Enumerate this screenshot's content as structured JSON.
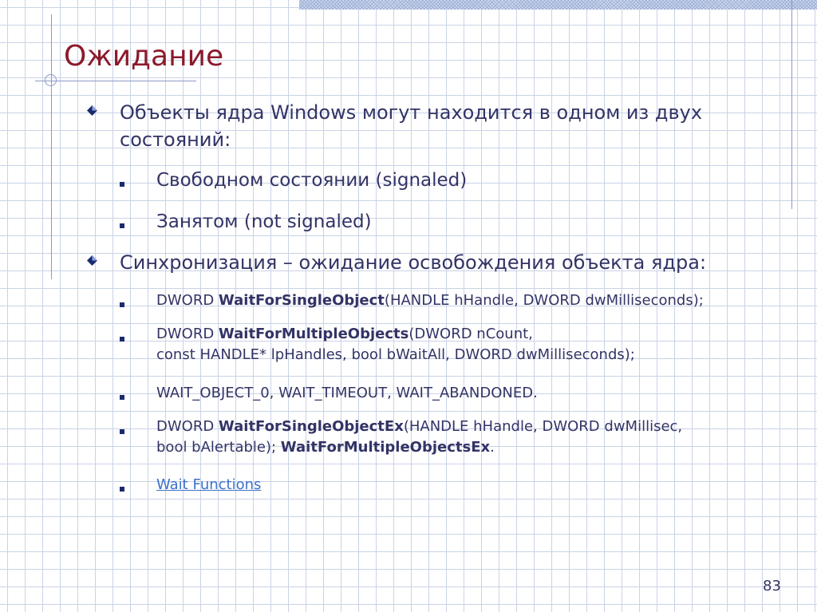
{
  "slide": {
    "title": "Ожидание",
    "page_number": "83"
  },
  "bullets": {
    "b1_line1": "Объекты ядра Windows могут находится в одном из двух",
    "b1_line2": "состояний:",
    "sub1": "Свободном состоянии (signaled)",
    "sub2": "Занятом (not signaled)",
    "b2": "Синхронизация – ожидание освобождения объекта ядра:"
  },
  "code": {
    "c1_pre": "DWORD ",
    "c1_bold": "WaitForSingleObject",
    "c1_post": "(HANDLE hHandle, DWORD dwMilliseconds);",
    "c2_pre": "DWORD ",
    "c2_bold": "WaitForMultipleObjects",
    "c2_post": "(DWORD nCount,",
    "c2_line2": "const HANDLE* lpHandles, bool bWaitAll, DWORD dwMilliseconds);",
    "c3": "WAIT_OBJECT_0, WAIT_TIMEOUT, WAIT_ABANDONED.",
    "c4_pre": "DWORD ",
    "c4_bold": "WaitForSingleObjectEx",
    "c4_post": "(HANDLE hHandle, DWORD dwMillisec,",
    "c4_line2_pre": "bool bAlertable); ",
    "c4_line2_bold": "WaitForMultipleObjectsEx",
    "c4_line2_post": ".",
    "link_text": "Wait Functions"
  },
  "colors": {
    "title": "#8b1a2b",
    "text": "#333366",
    "link": "#3b72c9",
    "grid": "#c9d3e6",
    "decor_lines": "#8c9bc7"
  },
  "icons": {
    "level1_bullet": "diamond-bullet-icon",
    "level2_bullet": "square-bullet-icon"
  }
}
